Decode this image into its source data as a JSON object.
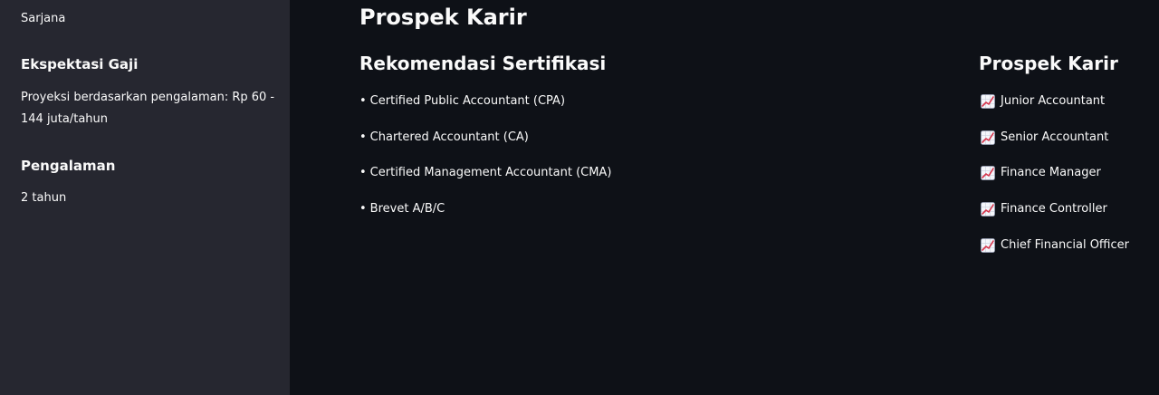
{
  "sidebar": {
    "education_value": "Sarjana",
    "salary_heading": "Ekspektasi Gaji",
    "salary_line1": "Proyeksi berdasarkan pengalaman: Rp 60 -",
    "salary_line2": "144 juta/tahun",
    "experience_heading": "Pengalaman",
    "experience_value": "2 tahun"
  },
  "main": {
    "title": "Prospek Karir",
    "certifications": {
      "heading": "Rekomendasi Sertifikasi",
      "bullet": "•",
      "items": [
        "Certified Public Accountant (CPA)",
        "Chartered Accountant (CA)",
        "Certified Management Accountant (CMA)",
        "Brevet A/B/C"
      ]
    },
    "career": {
      "heading": "Prospek Karir",
      "icon": "chart-increasing-icon",
      "items": [
        "Junior Accountant",
        "Senior Accountant",
        "Finance Manager",
        "Finance Controller",
        "Chief Financial Officer"
      ]
    }
  },
  "colors": {
    "sidebar_bg": "#262730",
    "main_bg": "#0e1117",
    "text": "#fafafa"
  }
}
